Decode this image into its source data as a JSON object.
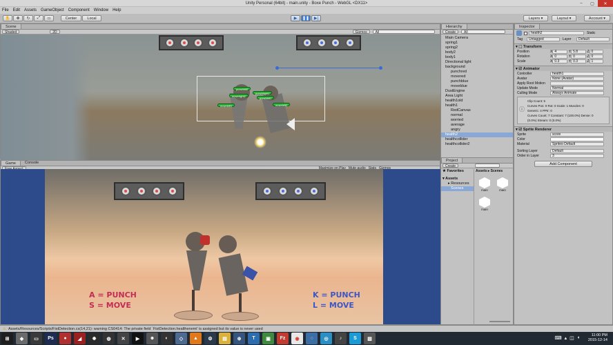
{
  "window": {
    "title": "Unity Personal (64bit) - main.unity - Boxe Punch - WebGL <DX11>",
    "controls": [
      "–",
      "▢",
      "✕"
    ]
  },
  "menu": [
    "File",
    "Edit",
    "Assets",
    "GameObject",
    "Component",
    "Window",
    "Help"
  ],
  "toolbar": {
    "center": "Center",
    "local": "Local",
    "layers": "Layers",
    "layout": "Layout",
    "account": "Account",
    "play": "▶",
    "pause": "❚❚",
    "step": "▶|"
  },
  "scene": {
    "tab": "Scene",
    "shading": "Shaded",
    "mode2d": "2D",
    "gizmos": "Gizmos",
    "search": "All"
  },
  "game": {
    "tab": "Game",
    "console_tab": "Console",
    "aspect": "Free Aspect",
    "options": [
      "Maximize on Play",
      "Mute audio",
      "Stats",
      "Gizmos"
    ],
    "controls_left": {
      "a": "A = PUNCH",
      "s": "S = MOVE"
    },
    "controls_right": {
      "k": "K = PUNCH",
      "l": "L = MOVE"
    }
  },
  "bubbles": [
    "punchhit2",
    "punchlight1",
    "moveright2",
    "punchhit1",
    "moveleft1",
    "moveleft2"
  ],
  "hierarchy": {
    "tab": "Hierarchy",
    "create": "Create",
    "search": "All",
    "items": [
      {
        "t": "Main Camera",
        "i": 0
      },
      {
        "t": "spring1",
        "i": 0
      },
      {
        "t": "spring2",
        "i": 0
      },
      {
        "t": "body2",
        "i": 0
      },
      {
        "t": "body1",
        "i": 0
      },
      {
        "t": "Directional light",
        "i": 0
      },
      {
        "t": "background",
        "i": 0
      },
      {
        "t": "punchred",
        "i": 1
      },
      {
        "t": "movered",
        "i": 1
      },
      {
        "t": "punchblue",
        "i": 1
      },
      {
        "t": "moveblue",
        "i": 1
      },
      {
        "t": "DustEngine",
        "i": 0
      },
      {
        "t": "Area Light",
        "i": 0
      },
      {
        "t": "health1old",
        "i": 0
      },
      {
        "t": "health1",
        "i": 0
      },
      {
        "t": "RedCanvas",
        "i": 1
      },
      {
        "t": "normal",
        "i": 1
      },
      {
        "t": "worried",
        "i": 1
      },
      {
        "t": "average",
        "i": 1
      },
      {
        "t": "angry",
        "i": 1
      },
      {
        "t": "health2",
        "i": 0,
        "sel": true
      },
      {
        "t": "healthcollider",
        "i": 0
      },
      {
        "t": "healthcollider2",
        "i": 0
      }
    ]
  },
  "project": {
    "tab": "Project",
    "create": "Create",
    "favorites": "Favorites",
    "assets": "Assets",
    "resources": "Resources",
    "scenes": "Scenes",
    "crumb": "Assets ▸ Scenes",
    "files": [
      "main",
      "main",
      "main"
    ]
  },
  "inspector": {
    "tab": "Inspector",
    "object": "health2",
    "static": "Static",
    "tag_label": "Tag",
    "tag": "Untagged",
    "layer_label": "Layer",
    "layer": "Default",
    "transform": {
      "title": "Transform",
      "position": [
        "Position",
        "4",
        "5.8",
        "0"
      ],
      "rotation": [
        "Rotation",
        "0",
        "0",
        "0"
      ],
      "scale": [
        "Scale",
        "0.3",
        "0.3",
        "1"
      ]
    },
    "animator": {
      "title": "Animator",
      "rows": [
        [
          "Controller",
          "health1"
        ],
        [
          "Avatar",
          "None (Avatar)"
        ],
        [
          "Apply Root Motion",
          ""
        ],
        [
          "Update Mode",
          "Normal"
        ],
        [
          "Culling Mode",
          "Always Animate"
        ]
      ],
      "info": [
        "Clip Count: 5",
        "Curves Pos: 0 Rot: 0 Scale: 1 Muscles: 0",
        "Generic: 4 PPtr: 0",
        "Curves Count: 7 Constant: 7 (100.0%) Dense: 0",
        "(0.0%) Stream: 0 (0.0%)"
      ]
    },
    "sprite": {
      "title": "Sprite Renderer",
      "rows": [
        [
          "Sprite",
          "score"
        ],
        [
          "Color",
          ""
        ],
        [
          "Material",
          "Sprites-Default"
        ],
        [
          "Sorting Layer",
          "Default"
        ],
        [
          "Order in Layer",
          "3"
        ]
      ]
    },
    "add_component": "Add Component"
  },
  "status": "Assets/Resources/Scripts/FistDetection.cs(14,21): warning CS0414: The private field `FistDetection.healthenemi' is assigned but its value is never used",
  "clock": {
    "time": "11:00 PM",
    "date": "2015-12-14"
  },
  "colors": {
    "accent": "#3b7bd6",
    "panel": "#c2c2c2",
    "selected": "#8aa8d6"
  }
}
